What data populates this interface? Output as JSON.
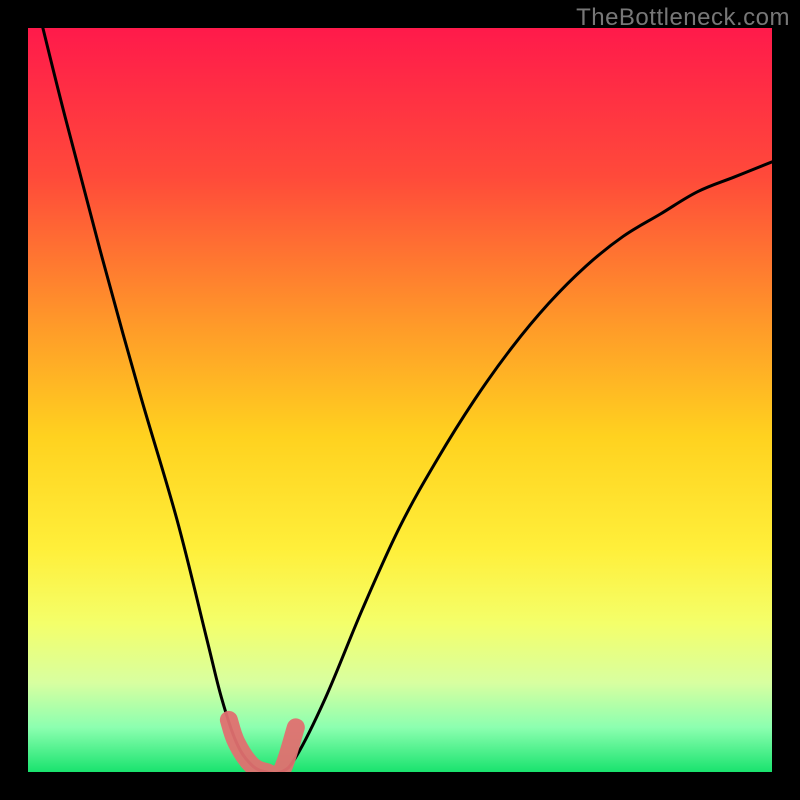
{
  "watermark": "TheBottleneck.com",
  "chart_data": {
    "type": "line",
    "title": "",
    "xlabel": "",
    "ylabel": "",
    "xlim": [
      0,
      100
    ],
    "ylim": [
      0,
      100
    ],
    "series": [
      {
        "name": "bottleneck-curve",
        "x": [
          2,
          5,
          10,
          15,
          20,
          24,
          26,
          28,
          30,
          32,
          34,
          36,
          40,
          45,
          50,
          55,
          60,
          65,
          70,
          75,
          80,
          85,
          90,
          95,
          100
        ],
        "values": [
          100,
          88,
          69,
          51,
          34,
          18,
          10,
          4,
          1,
          0,
          0,
          2,
          10,
          22,
          33,
          42,
          50,
          57,
          63,
          68,
          72,
          75,
          78,
          80,
          82
        ]
      }
    ],
    "highlight": {
      "name": "optimal-zone",
      "x": [
        27,
        28,
        30,
        32,
        34,
        36
      ],
      "values": [
        7,
        4,
        1,
        0,
        0,
        6
      ]
    },
    "gradient_stops": [
      {
        "pos": 0.0,
        "color": "#ff1a4b"
      },
      {
        "pos": 0.2,
        "color": "#ff4a3a"
      },
      {
        "pos": 0.4,
        "color": "#ff9a29"
      },
      {
        "pos": 0.55,
        "color": "#ffd21f"
      },
      {
        "pos": 0.7,
        "color": "#ffef3a"
      },
      {
        "pos": 0.8,
        "color": "#f4ff6a"
      },
      {
        "pos": 0.88,
        "color": "#d8ffa0"
      },
      {
        "pos": 0.94,
        "color": "#8cffb0"
      },
      {
        "pos": 1.0,
        "color": "#19e36e"
      }
    ]
  }
}
